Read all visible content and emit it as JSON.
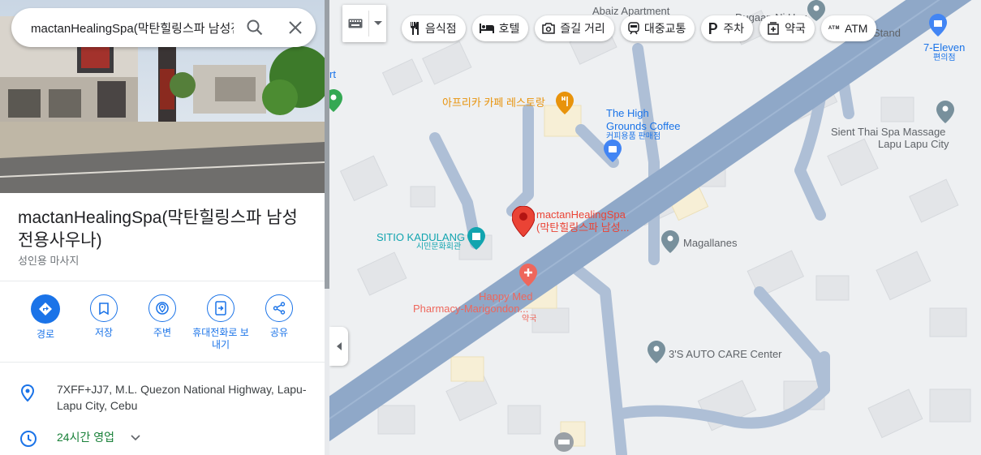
{
  "search": {
    "query": "mactanHealingSpa(막탄힐링스파 남성전용사우나)"
  },
  "place": {
    "title": "mactanHealingSpa(막탄힐링스파 남성전용사우나)",
    "category": "성인용 마사지",
    "address": "7XFF+JJ7, M.L. Quezon National Highway, Lapu-Lapu City, Cebu",
    "hours": "24시간 영업"
  },
  "actions": [
    {
      "label": "경로",
      "icon": "directions-icon"
    },
    {
      "label": "저장",
      "icon": "bookmark-icon"
    },
    {
      "label": "주변",
      "icon": "nearby-icon"
    },
    {
      "label": "휴대전화로 보내기",
      "icon": "send-to-phone-icon"
    },
    {
      "label": "공유",
      "icon": "share-icon"
    }
  ],
  "chips": [
    {
      "label": "음식점",
      "icon": "restaurant-icon"
    },
    {
      "label": "호텔",
      "icon": "hotel-icon"
    },
    {
      "label": "즐길 거리",
      "icon": "camera-icon"
    },
    {
      "label": "대중교통",
      "icon": "transit-icon"
    },
    {
      "label": "주차",
      "icon": "parking-icon"
    },
    {
      "label": "약국",
      "icon": "pharmacy-icon"
    },
    {
      "label": "ATM",
      "icon": "atm-icon",
      "badge": "ATM"
    }
  ],
  "map_labels": {
    "abaiz": "Abaiz Apartment",
    "dugaan": "Dugaan Ni Hoy",
    "stand": "Stand",
    "seven_eleven": "7-Eleven",
    "seven_eleven_sub": "편의점",
    "cafe_korean": "아프리카 카페 레스토랑",
    "high_grounds_1": "The High",
    "high_grounds_2": "Grounds Coffee",
    "high_grounds_sub": "커피용품 판매점",
    "sient_1": "Sient Thai Spa Massage",
    "sient_2": "Lapu Lapu City",
    "spa_1": "mactanHealingSpa",
    "spa_2": "(막탄힐링스파 남성...",
    "sitio": "SITIO KADULANG",
    "sitio_sub": "시민문화회관",
    "magallanes": "Magallanes",
    "happy_1": "Happy Med",
    "happy_2": "Pharmacy-Marigondon...",
    "happy_sub": "약국",
    "auto": "3'S AUTO CARE Center",
    "rt": "rt"
  },
  "colors": {
    "accent": "#1a73e8",
    "road_major": "#8fa8c8",
    "road_minor": "#aebfd6",
    "pin_red": "#ea4335",
    "poi_orange": "#e8930c",
    "poi_teal": "#12a4af",
    "poi_blue": "#4285f4",
    "poi_gray": "#78909c",
    "pharmacy_red": "#ee675c"
  }
}
